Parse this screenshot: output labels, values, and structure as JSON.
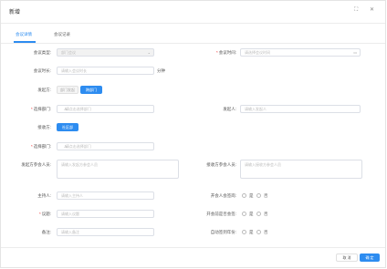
{
  "dialog": {
    "title": "新增",
    "fullscreen_icon": "expand-icon",
    "close_icon": "close-icon"
  },
  "tabs": [
    {
      "label": "会议详情",
      "active": true
    },
    {
      "label": "会议记录",
      "active": false
    }
  ],
  "form": {
    "meeting_type": {
      "label": "会议类型:",
      "value": "部门会议"
    },
    "meeting_time": {
      "label": "会议时间:",
      "placeholder": "请选择会议时间"
    },
    "meeting_duration": {
      "label": "会议时长:",
      "placeholder": "请输入会议时长",
      "unit": "分钟"
    },
    "initiator": {
      "label": "发起方:",
      "options": [
        "部门发起",
        "跨部门"
      ],
      "selected": "跨部门"
    },
    "select_dept": {
      "label": "选择部门:",
      "placeholder": "请点击选择部门"
    },
    "initiator_person": {
      "label": "发起人:",
      "placeholder": "请输入发起人"
    },
    "receiver": {
      "label": "接收方:",
      "button": "社区部"
    },
    "select_dept2": {
      "label": "选择部门:",
      "placeholder": "请点击选择部门"
    },
    "initiator_participants": {
      "label": "发起方参会人员:",
      "placeholder": "请输入发起方参会人员"
    },
    "receiver_participants": {
      "label": "接收方参会人员:",
      "placeholder": "请输入接收方参会人员"
    },
    "presenter": {
      "label": "主持人:",
      "placeholder": "请输入主持人"
    },
    "need_approval": {
      "label": "开会人会签岗:",
      "yes": "是",
      "no": "否"
    },
    "subject": {
      "label": "议题:",
      "placeholder": "请输入议题"
    },
    "need_summary": {
      "label": "开会前是否会签:",
      "yes": "是",
      "no": "否"
    },
    "remarks": {
      "label": "备注:",
      "placeholder": "请输入备注"
    },
    "auto_sign": {
      "label": "自动签到年份:",
      "yes": "是",
      "no": "否"
    }
  },
  "footer": {
    "cancel": "取 消",
    "confirm": "确 定"
  },
  "colors": {
    "primary": "#2d8cf0",
    "required": "#e33333"
  }
}
